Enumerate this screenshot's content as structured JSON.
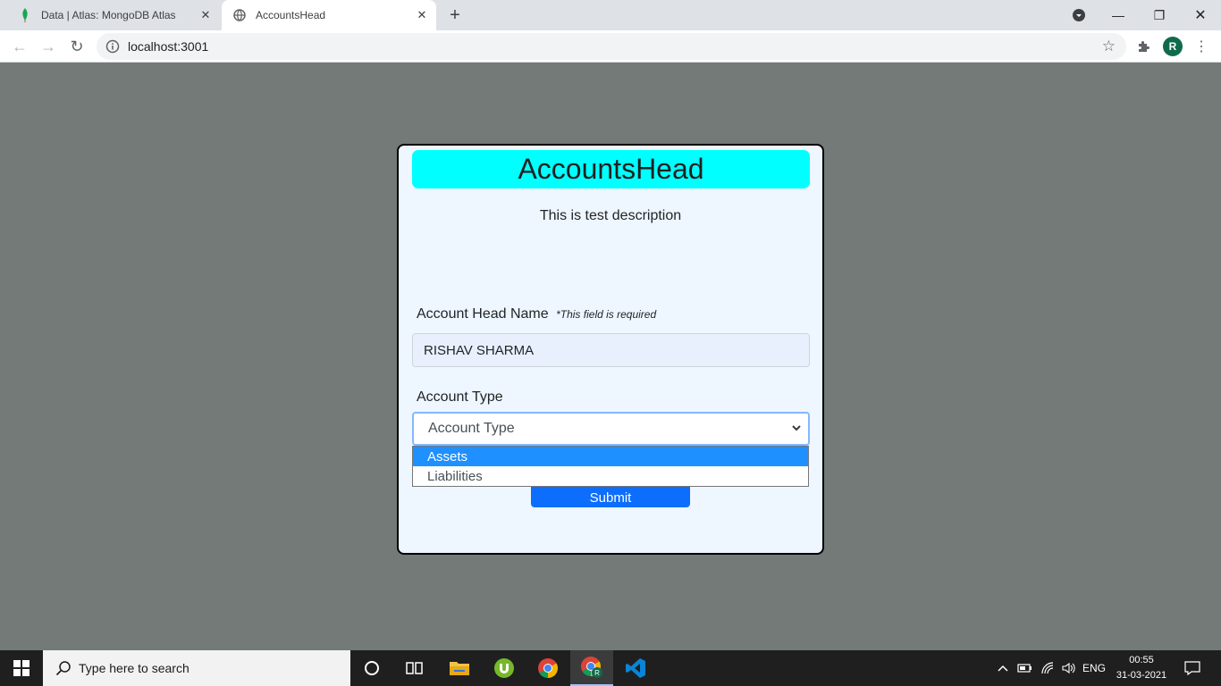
{
  "browser": {
    "tabs": [
      {
        "title": "Data | Atlas: MongoDB Atlas",
        "active": false,
        "icon": "mongodb-leaf-icon"
      },
      {
        "title": "AccountsHead",
        "active": true,
        "icon": "globe-icon"
      }
    ],
    "url": "localhost:3001",
    "profile_initial": "R"
  },
  "page": {
    "header": "AccountsHead",
    "description": "This is test description",
    "name_label": "Account Head Name",
    "name_required_note": "*This field is required",
    "name_value": "RISHAV SHARMA",
    "type_label": "Account Type",
    "type_selected": "Account Type",
    "type_options": [
      "Assets",
      "Liabilities"
    ],
    "highlighted_option": "Assets",
    "submit_label": "Submit"
  },
  "taskbar": {
    "search_placeholder": "Type here to search",
    "language": "ENG",
    "time": "00:55",
    "date": "31-03-2021",
    "apps": [
      "cortana-icon",
      "task-view-icon",
      "file-explorer-icon",
      "utorrent-icon",
      "chrome-icon",
      "chrome-profile-icon",
      "vscode-icon"
    ]
  },
  "colors": {
    "page_background": "#737a78",
    "card_background": "#eef6ff",
    "header_background": "#00ffff",
    "submit_button": "#0d6efd",
    "option_highlight": "#1e90ff"
  }
}
